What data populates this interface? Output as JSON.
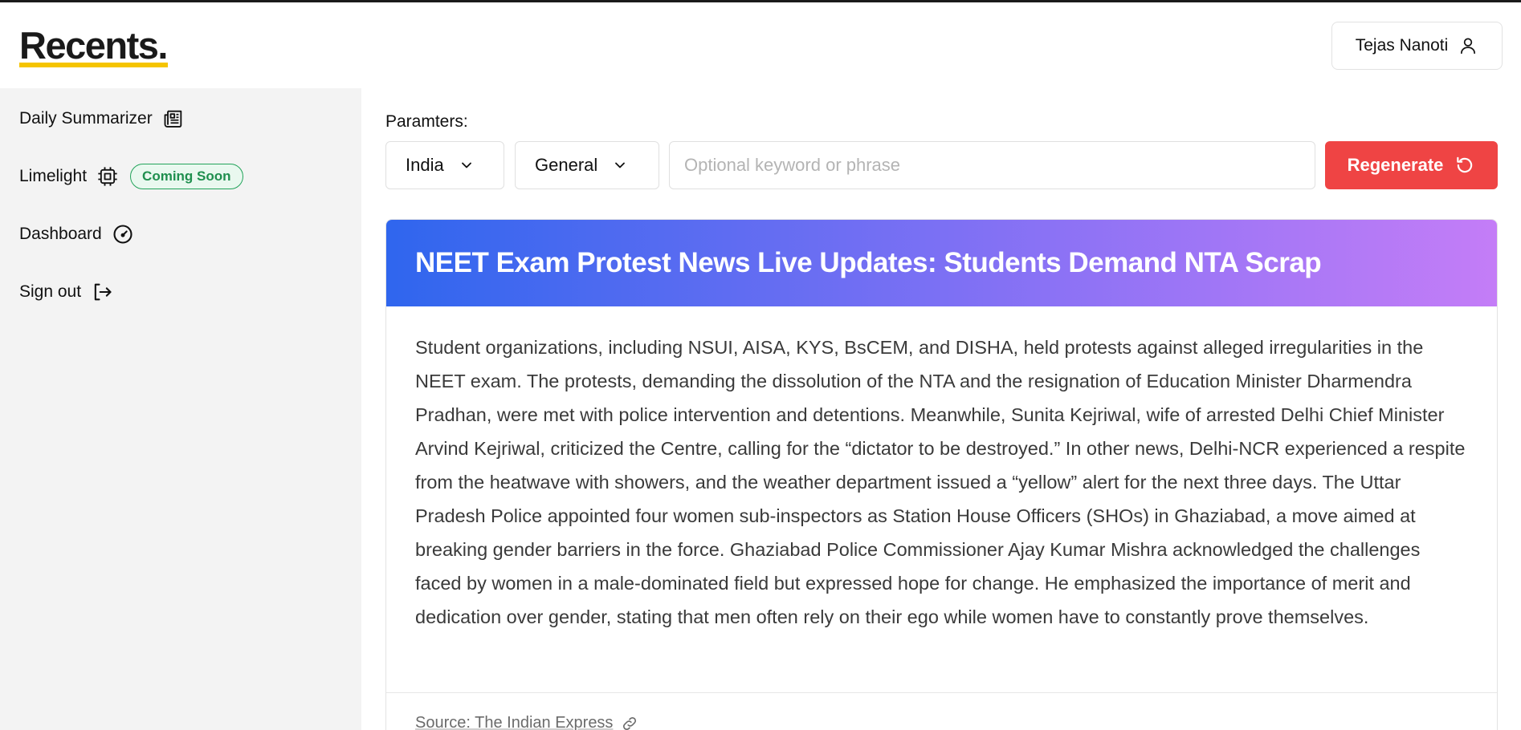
{
  "header": {
    "logo": "Recents.",
    "user_name": "Tejas Nanoti"
  },
  "sidebar": {
    "items": [
      {
        "label": "Daily Summarizer",
        "icon": "newspaper-icon"
      },
      {
        "label": "Limelight",
        "icon": "cpu-chip-icon",
        "badge": "Coming Soon"
      },
      {
        "label": "Dashboard",
        "icon": "gauge-icon"
      },
      {
        "label": "Sign out",
        "icon": "sign-out-icon"
      }
    ]
  },
  "params": {
    "label": "Paramters:",
    "region": "India",
    "category": "General",
    "keyword_placeholder": "Optional keyword or phrase",
    "keyword_value": "",
    "regenerate_label": "Regenerate"
  },
  "article": {
    "title": "NEET Exam Protest News Live Updates: Students Demand NTA Scrap",
    "body": "Student organizations, including NSUI, AISA, KYS, BsCEM, and DISHA, held protests against alleged irregularities in the NEET exam. The protests, demanding the dissolution of the NTA and the resignation of Education Minister Dharmendra Pradhan, were met with police intervention and detentions. Meanwhile, Sunita Kejriwal, wife of arrested Delhi Chief Minister Arvind Kejriwal, criticized the Centre, calling for the “dictator to be destroyed.” In other news, Delhi-NCR experienced a respite from the heatwave with showers, and the weather department issued a “yellow” alert for the next three days. The Uttar Pradesh Police appointed four women sub-inspectors as Station House Officers (SHOs) in Ghaziabad, a move aimed at breaking gender barriers in the force. Ghaziabad Police Commissioner Ajay Kumar Mishra acknowledged the challenges faced by women in a male-dominated field but expressed hope for change. He emphasized the importance of merit and dedication over gender, stating that men often rely on their ego while women have to constantly prove themselves.",
    "source": "Source: The Indian Express"
  },
  "colors": {
    "accent_yellow": "#f5c400",
    "regenerate_red": "#ef4444",
    "gradient_start": "#2f66ee",
    "gradient_end": "#c47df7",
    "badge_green": "#22a35a"
  }
}
